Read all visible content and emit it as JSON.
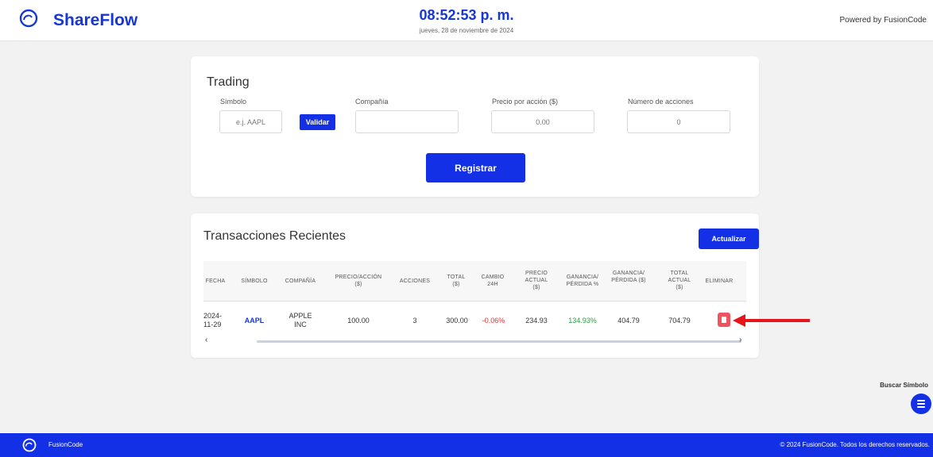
{
  "header": {
    "brand": "ShareFlow",
    "clock": "08:52:53 p. m.",
    "date": "jueves, 28 de noviembre de 2024",
    "powered_by": "Powered by FusionCode"
  },
  "trading": {
    "title": "Trading",
    "symbol_label": "Símbolo",
    "symbol_placeholder": "e.j. AAPL",
    "validate_label": "Validar",
    "company_label": "Compañía",
    "company_value": "",
    "price_label": "Precio por acción ($)",
    "price_placeholder": "0.00",
    "shares_label": "Número de acciones",
    "shares_placeholder": "0",
    "register_label": "Registrar"
  },
  "transactions": {
    "title": "Transacciones Recientes",
    "refresh_label": "Actualizar",
    "columns": [
      "FECHA",
      "SÍMBOLO",
      "COMPAÑÍA",
      "PRECIO/ACCIÓN ($)",
      "ACCIONES",
      "TOTAL ($)",
      "CAMBIO 24H",
      "PRECIO ACTUAL ($)",
      "GANANCIA/ PÉRDIDA %",
      "GANANCIA/ PÉRDIDA ($)",
      "TOTAL ACTUAL ($)",
      "ELIMINAR"
    ],
    "rows": [
      {
        "date": "2024-11-29",
        "symbol": "AAPL",
        "company": "APPLE INC",
        "price": "100.00",
        "shares": "3",
        "total": "300.00",
        "change_24h": "-0.06%",
        "current_price": "234.93",
        "gain_pct": "134.93%",
        "gain_amount": "404.79",
        "current_total": "704.79"
      }
    ],
    "scroll_left": "‹",
    "scroll_right": "›"
  },
  "search": {
    "label": "Buscar Símbolo"
  },
  "footer": {
    "brand": "FusionCode",
    "copyright": "© 2024 FusionCode. Todos los derechos reservados."
  },
  "colors": {
    "brand_blue": "#1430e6",
    "negative": "#e53030",
    "positive": "#22a33a",
    "delete": "#ee5460",
    "annotation_arrow": "#e8141c"
  },
  "icons": {
    "logo": "swirl-logo-icon",
    "delete": "trash-icon",
    "search_fab": "menu-icon"
  }
}
